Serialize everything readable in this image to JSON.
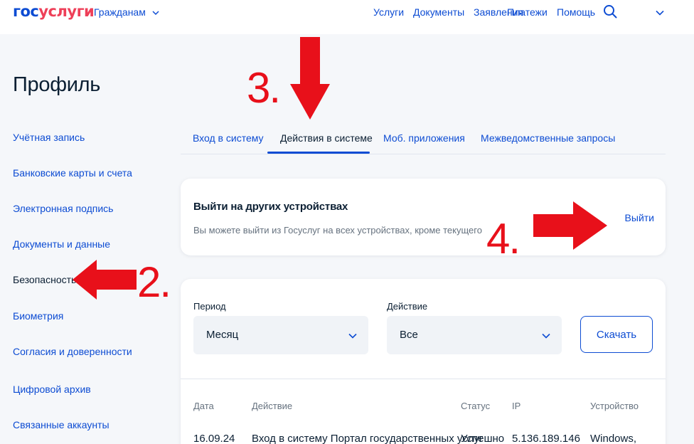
{
  "header": {
    "logo_part1": "гос",
    "logo_part2": "услуги",
    "citizens_menu": "Гражданам",
    "nav": [
      "Услуги",
      "Документы",
      "Заявления",
      "Платежи",
      "Помощь"
    ],
    "search_icon": "search-icon",
    "user_menu_icon": "chevron-down-icon"
  },
  "page": {
    "title": "Профиль"
  },
  "sidebar": {
    "items": [
      {
        "label": "Учётная запись",
        "active": false
      },
      {
        "label": "Банковские карты и счета",
        "active": false
      },
      {
        "label": "Электронная подпись",
        "active": false
      },
      {
        "label": "Документы и данные",
        "active": false
      },
      {
        "label": "Безопасность",
        "active": true
      },
      {
        "label": "Биометрия",
        "active": false
      },
      {
        "label": "Согласия и доверенности",
        "active": false
      },
      {
        "label": "Цифровой архив",
        "active": false
      },
      {
        "label": "Связанные аккаунты",
        "active": false
      }
    ]
  },
  "tabs": [
    {
      "label": "Вход в систему",
      "active": false
    },
    {
      "label": "Действия в системе",
      "active": true
    },
    {
      "label": "Моб. приложения",
      "active": false
    },
    {
      "label": "Межведомственные запросы",
      "active": false
    }
  ],
  "logout_card": {
    "title": "Выйти на других устройствах",
    "description": "Вы можете выйти из Госуслуг на всех устройствах, кроме текущего",
    "link": "Выйти"
  },
  "filters": {
    "period_label": "Период",
    "period_value": "Месяц",
    "action_label": "Действие",
    "action_value": "Все",
    "download_button": "Скачать"
  },
  "table": {
    "columns": [
      "Дата",
      "Действие",
      "Статус",
      "IP",
      "Устройство"
    ],
    "rows": [
      [
        "16.09.24",
        "Вход в систему Портал государственных услуг",
        "Успешно",
        "5.136.189.146",
        "Windows,"
      ]
    ]
  },
  "annotations": [
    {
      "number": "2.",
      "color": "#e8101a"
    },
    {
      "number": "3.",
      "color": "#e8101a"
    },
    {
      "number": "4.",
      "color": "#e8101a"
    }
  ],
  "colors": {
    "accent": "#0d4cd3",
    "brand_red": "#ee3f58",
    "annotation_red": "#e8101a",
    "text": "#0b1f33",
    "muted": "#66727f"
  }
}
